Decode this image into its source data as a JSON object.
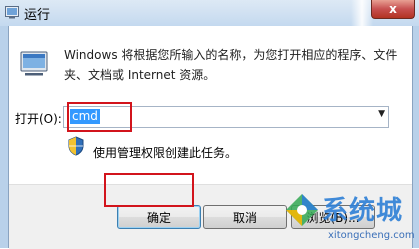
{
  "window": {
    "title": "运行",
    "close_label": "x"
  },
  "description": "Windows 将根据您所输入的名称，为您打开相应的程序、文件夹、文档或 Internet 资源。",
  "open_field": {
    "label": "打开(O):",
    "value": "cmd"
  },
  "admin_note": "使用管理权限创建此任务。",
  "buttons": {
    "ok": "确定",
    "cancel": "取消",
    "browse": "浏览(B)..."
  },
  "watermark": {
    "text": "系统城",
    "url": "xitongcheng.com"
  },
  "colors": {
    "highlight": "#d2141c",
    "selection": "#3399ff",
    "watermark": "#2e7fd6"
  }
}
